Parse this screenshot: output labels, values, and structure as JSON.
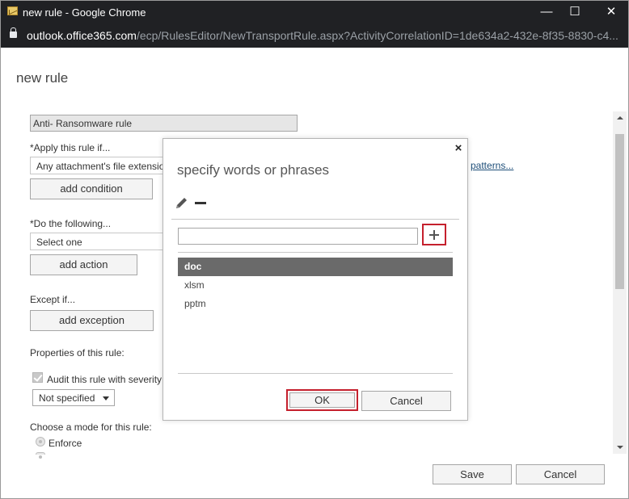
{
  "browser": {
    "window_title": "new rule - Google Chrome",
    "url_host": "outlook.office365.com",
    "url_path": "/ecp/RulesEditor/NewTransportRule.aspx?ActivityCorrelationID=1de634a2-432e-8f35-8830-c4...",
    "minimize_glyph": "—",
    "maximize_glyph": "☐",
    "close_glyph": "✕"
  },
  "page": {
    "title": "new rule",
    "rule_name_value": "Anti- Ransomware rule",
    "apply_label": "*Apply this rule if...",
    "apply_select_value": "Any attachment's file extensio",
    "patterns_link": "patterns...",
    "add_condition_label": "add condition",
    "do_label": "*Do the following...",
    "do_select_value": "Select one",
    "add_action_label": "add action",
    "except_label": "Except if...",
    "add_exception_label": "add exception",
    "properties_label": "Properties of this rule:",
    "audit_label": "Audit this rule with severity",
    "severity_value": "Not specified",
    "mode_label": "Choose a mode for this rule:",
    "enforce_label": "Enforce",
    "save_label": "Save",
    "cancel_label": "Cancel"
  },
  "dialog": {
    "title": "specify words or phrases",
    "close_glyph": "×",
    "input_value": "",
    "words": [
      "doc",
      "xlsm",
      "pptm"
    ],
    "selected_index": 0,
    "ok_label": "OK",
    "cancel_label": "Cancel"
  },
  "colors": {
    "highlight_border": "#c5202d",
    "selected_row": "#6a6a6a",
    "chrome_bar": "#202124"
  }
}
